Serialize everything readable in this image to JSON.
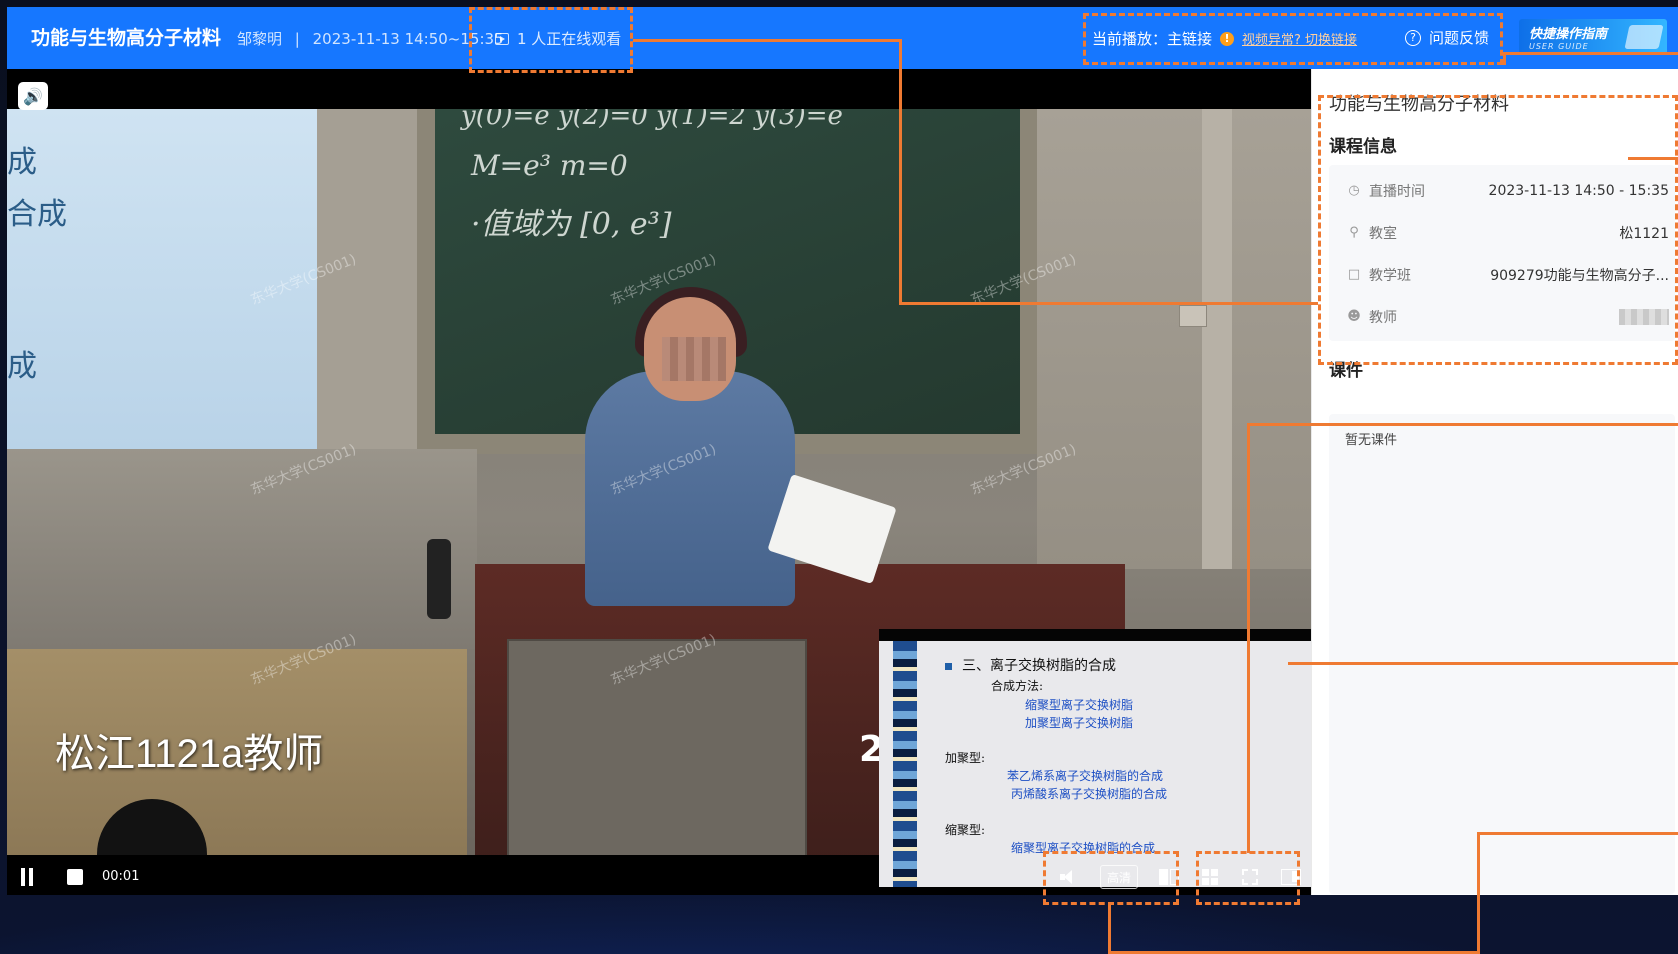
{
  "header": {
    "course_title": "功能与生物高分子材料",
    "teacher": "邹黎明",
    "separator": "|",
    "time_range": "2023-11-13 14:50~15:35",
    "online_viewers": "1 人正在线观看",
    "current_play_label": "当前播放：主链接",
    "warn_icon": "!",
    "switch_link": "视频异常? 切换链接",
    "feedback_label": "问题反馈",
    "feedback_icon": "?",
    "guide_title": "快捷操作指南",
    "guide_subtitle": "USER GUIDE"
  },
  "video": {
    "projection_lines": [
      "成",
      "合成",
      "成"
    ],
    "board_lines": [
      "y(0)=e   y(2)=0   y(1)=2   y(3)=e",
      "M=e³   m=0",
      "·值域为 [0, e³]"
    ],
    "watermark": "东华大学(CS001)",
    "caption": "松江1121a教师",
    "caption_number": "2"
  },
  "slide": {
    "heading": "三、离子交换树脂的合成",
    "method_label": "合成方法:",
    "methods": [
      "缩聚型离子交换树脂",
      "加聚型离子交换树脂"
    ],
    "addition_label": "加聚型:",
    "addition_items": [
      "苯乙烯系离子交换树脂的合成",
      "丙烯酸系离子交换树脂的合成"
    ],
    "condensation_label": "缩聚型:",
    "condensation_items": [
      "缩聚型离子交换树脂的合成"
    ]
  },
  "controls": {
    "time": "00:01",
    "quality": "高清"
  },
  "sidebar": {
    "course_title": "功能与生物高分子材料",
    "info_heading": "课程信息",
    "info": [
      {
        "icon": "clock-icon",
        "label": "直播时间",
        "value": "2023-11-13 14:50 - 15:35"
      },
      {
        "icon": "location-icon",
        "label": "教室",
        "value": "松1121"
      },
      {
        "icon": "book-icon",
        "label": "教学班",
        "value": "909279功能与生物高分子..."
      },
      {
        "icon": "user-icon",
        "label": "教师",
        "value": ""
      }
    ],
    "courseware_heading": "课件",
    "courseware_empty": "暂无课件"
  },
  "colors": {
    "header_blue": "#1677ff",
    "annotation_orange": "#ef7a32",
    "warn_orange": "#ff9f1a"
  }
}
